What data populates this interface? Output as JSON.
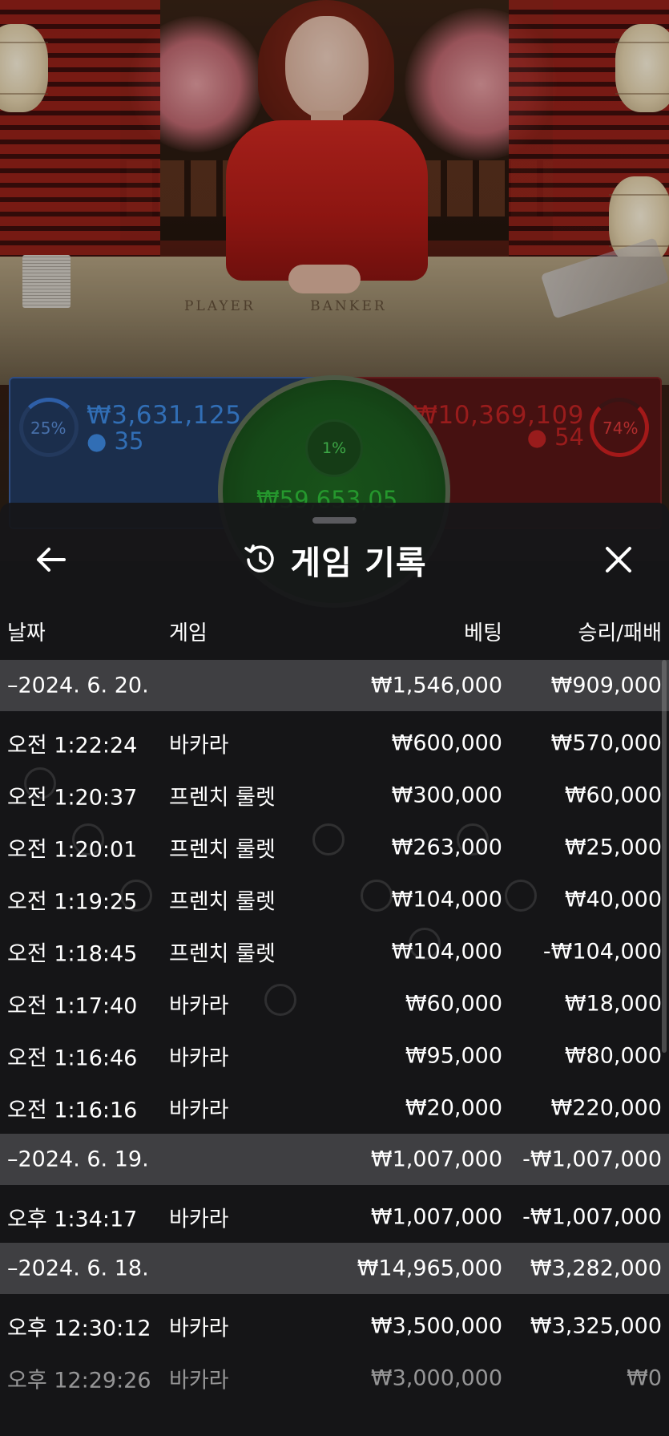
{
  "header": {
    "title": "게임 기록",
    "back_icon": "arrow-left-icon",
    "history_icon": "history-clock-icon",
    "close_icon": "close-x-icon"
  },
  "columns": {
    "date": "날짜",
    "game": "게임",
    "bet": "베팅",
    "result": "승리/패배"
  },
  "background_game": {
    "table_labels": [
      "PLAYER",
      "BANKER"
    ],
    "player": {
      "percent": "25%",
      "amount": "₩3,631,125",
      "players": "35"
    },
    "banker": {
      "percent": "74%",
      "amount": "₩10,369,109",
      "players": "54"
    },
    "tie": {
      "percent": "1%",
      "amount": "₩59,653,05"
    }
  },
  "days": [
    {
      "date": "–2024. 6. 20.",
      "bet_total": "₩1,546,000",
      "result_total": "₩909,000",
      "entries": [
        {
          "time": "오전 1:22:24",
          "game": "바카라",
          "bet": "₩600,000",
          "result": "₩570,000"
        },
        {
          "time": "오전 1:20:37",
          "game": "프렌치 룰렛",
          "bet": "₩300,000",
          "result": "₩60,000"
        },
        {
          "time": "오전 1:20:01",
          "game": "프렌치 룰렛",
          "bet": "₩263,000",
          "result": "₩25,000"
        },
        {
          "time": "오전 1:19:25",
          "game": "프렌치 룰렛",
          "bet": "₩104,000",
          "result": "₩40,000"
        },
        {
          "time": "오전 1:18:45",
          "game": "프렌치 룰렛",
          "bet": "₩104,000",
          "result": "-₩104,000"
        },
        {
          "time": "오전 1:17:40",
          "game": "바카라",
          "bet": "₩60,000",
          "result": "₩18,000"
        },
        {
          "time": "오전 1:16:46",
          "game": "바카라",
          "bet": "₩95,000",
          "result": "₩80,000"
        },
        {
          "time": "오전 1:16:16",
          "game": "바카라",
          "bet": "₩20,000",
          "result": "₩220,000"
        }
      ]
    },
    {
      "date": "–2024. 6. 19.",
      "bet_total": "₩1,007,000",
      "result_total": "-₩1,007,000",
      "entries": [
        {
          "time": "오후 1:34:17",
          "game": "바카라",
          "bet": "₩1,007,000",
          "result": "-₩1,007,000"
        }
      ]
    },
    {
      "date": "–2024. 6. 18.",
      "bet_total": "₩14,965,000",
      "result_total": "₩3,282,000",
      "entries": [
        {
          "time": "오후 12:30:12",
          "game": "바카라",
          "bet": "₩3,500,000",
          "result": "₩3,325,000"
        },
        {
          "time": "오후 12:29:26",
          "game": "바카라",
          "bet": "₩3,000,000",
          "result": "₩0"
        }
      ]
    }
  ]
}
